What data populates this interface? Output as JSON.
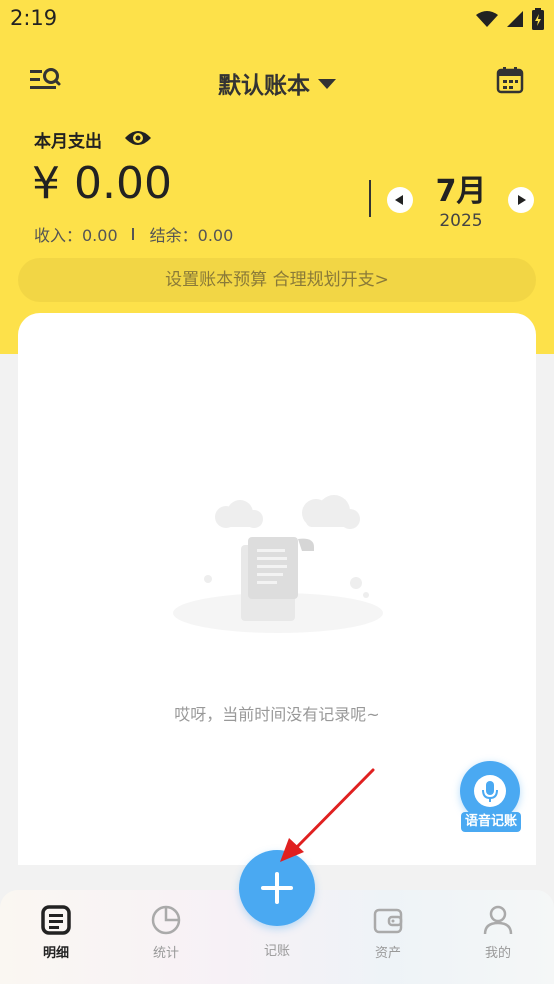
{
  "status_bar": {
    "time": "2:19"
  },
  "header": {
    "book_title": "默认账本"
  },
  "summary": {
    "month_label": "本月支出",
    "amount": "¥ 0.00",
    "income": "收入：0.00",
    "balance": "结余：0.00"
  },
  "month_selector": {
    "month": "7月",
    "year": "2025"
  },
  "budget_banner": "设置账本预算 合理规划开支>",
  "empty_state": {
    "message": "哎呀，当前时间没有记录呢~"
  },
  "voice": {
    "label": "语音记账"
  },
  "bottom_nav": {
    "items": [
      {
        "label": "明细",
        "icon": "list-icon",
        "active": true
      },
      {
        "label": "统计",
        "icon": "pie-chart-icon",
        "active": false
      },
      {
        "label": "记账",
        "icon": "plus-icon",
        "active": false
      },
      {
        "label": "资产",
        "icon": "wallet-icon",
        "active": false
      },
      {
        "label": "我的",
        "icon": "person-icon",
        "active": false
      }
    ]
  },
  "colors": {
    "brand_yellow": "#fde14a",
    "accent_blue": "#4aa9f2",
    "annotation_red": "#e02020"
  }
}
